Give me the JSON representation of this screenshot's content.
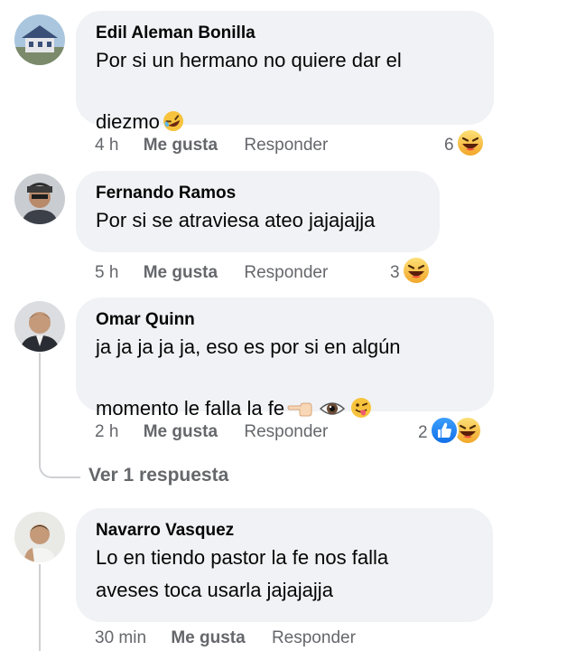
{
  "comments": [
    {
      "author": "Edil Aleman Bonilla",
      "text": "Por si un hermano no quiere dar el\ndiezmo",
      "inline_emojis": [
        "rolling-laughing-icon"
      ],
      "time": "4 h",
      "like_label": "Me gusta",
      "reply_label": "Responder",
      "reaction_count": "6",
      "reaction_icons": [
        "haha-icon"
      ]
    },
    {
      "author": "Fernando Ramos",
      "text": "Por si se atraviesa ateo jajajajja",
      "time": "5 h",
      "like_label": "Me gusta",
      "reply_label": "Responder",
      "reaction_count": "3",
      "reaction_icons": [
        "haha-icon"
      ]
    },
    {
      "author": "Omar Quinn",
      "text": "ja ja ja ja ja, eso es por si en algún\nmomento le falla la fe",
      "inline_emojis": [
        "pointing-left-hand-icon",
        "eye-icon",
        "winking-tongue-icon"
      ],
      "time": "2 h",
      "like_label": "Me gusta",
      "reply_label": "Responder",
      "reaction_count": "2",
      "reaction_icons": [
        "like-icon",
        "haha-icon"
      ],
      "view_replies": "Ver 1 respuesta"
    },
    {
      "author": "Navarro Vasquez",
      "text": "Lo en tiendo pastor la fe nos falla\naveses toca usarla jajajajja",
      "time": "30 min",
      "like_label": "Me gusta",
      "reply_label": "Responder"
    }
  ],
  "colors": {
    "bubble": "#f0f2f5",
    "secondary_text": "#65676b",
    "like_blue": "#1877f2",
    "haha_yellow": "#f7c33c",
    "thread_line": "#ced0d4"
  }
}
